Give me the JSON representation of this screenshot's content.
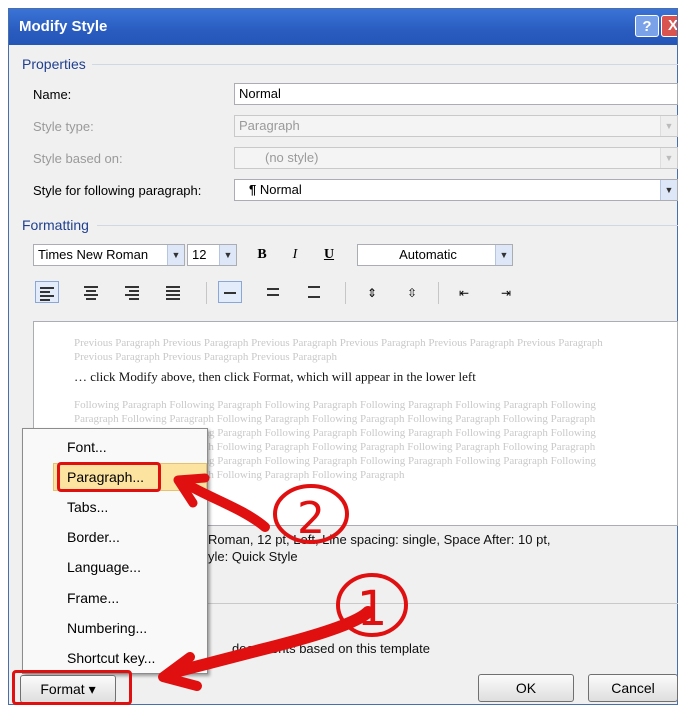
{
  "dialog": {
    "title": "Modify Style",
    "help_glyph": "?",
    "close_glyph": "X"
  },
  "properties": {
    "group_label": "Properties",
    "name_label": "Name:",
    "name_value": "Normal",
    "style_type_label": "Style type:",
    "style_type_value": "Paragraph",
    "based_on_label": "Style based on:",
    "based_on_value": "(no style)",
    "following_label": "Style for following paragraph:",
    "following_value": "Normal",
    "following_glyph": "¶"
  },
  "formatting": {
    "group_label": "Formatting",
    "font": "Times New Roman",
    "size": "12",
    "bold": "B",
    "italic": "I",
    "underline": "U",
    "color": "Automatic"
  },
  "preview": {
    "previous_text": "Previous Paragraph Previous Paragraph Previous Paragraph Previous Paragraph Previous Paragraph Previous Paragraph Previous Paragraph Previous Paragraph Previous Paragraph",
    "sample_text": "… click Modify above, then click Format, which will appear in the lower left",
    "following_text": "Following Paragraph Following Paragraph Following Paragraph Following Paragraph Following Paragraph Following Paragraph Following Paragraph Following Paragraph Following Paragraph Following Paragraph Following Paragraph Following Paragraph Following Paragraph Following Paragraph Following Paragraph Following Paragraph Following Paragraph Following Paragraph Following Paragraph Following Paragraph Following Paragraph Following Paragraph Following Paragraph Following Paragraph Following Paragraph Following Paragraph Following Paragraph Following Paragraph Following Paragraph Following Paragraph Following Paragraph"
  },
  "description": {
    "line1": "Roman, 12 pt, Left, Line spacing: single, Space After: 10 pt,",
    "line2": "yle: Quick Style",
    "template_text": "documents based on this template"
  },
  "format_menu": {
    "items": [
      "Font...",
      "Paragraph...",
      "Tabs...",
      "Border...",
      "Language...",
      "Frame...",
      "Numbering...",
      "Shortcut key..."
    ],
    "highlighted_index": 1
  },
  "buttons": {
    "format": "Format",
    "ok": "OK",
    "cancel": "Cancel"
  },
  "annotations": {
    "step1": "1",
    "step2": "2",
    "color": "#e01010"
  }
}
